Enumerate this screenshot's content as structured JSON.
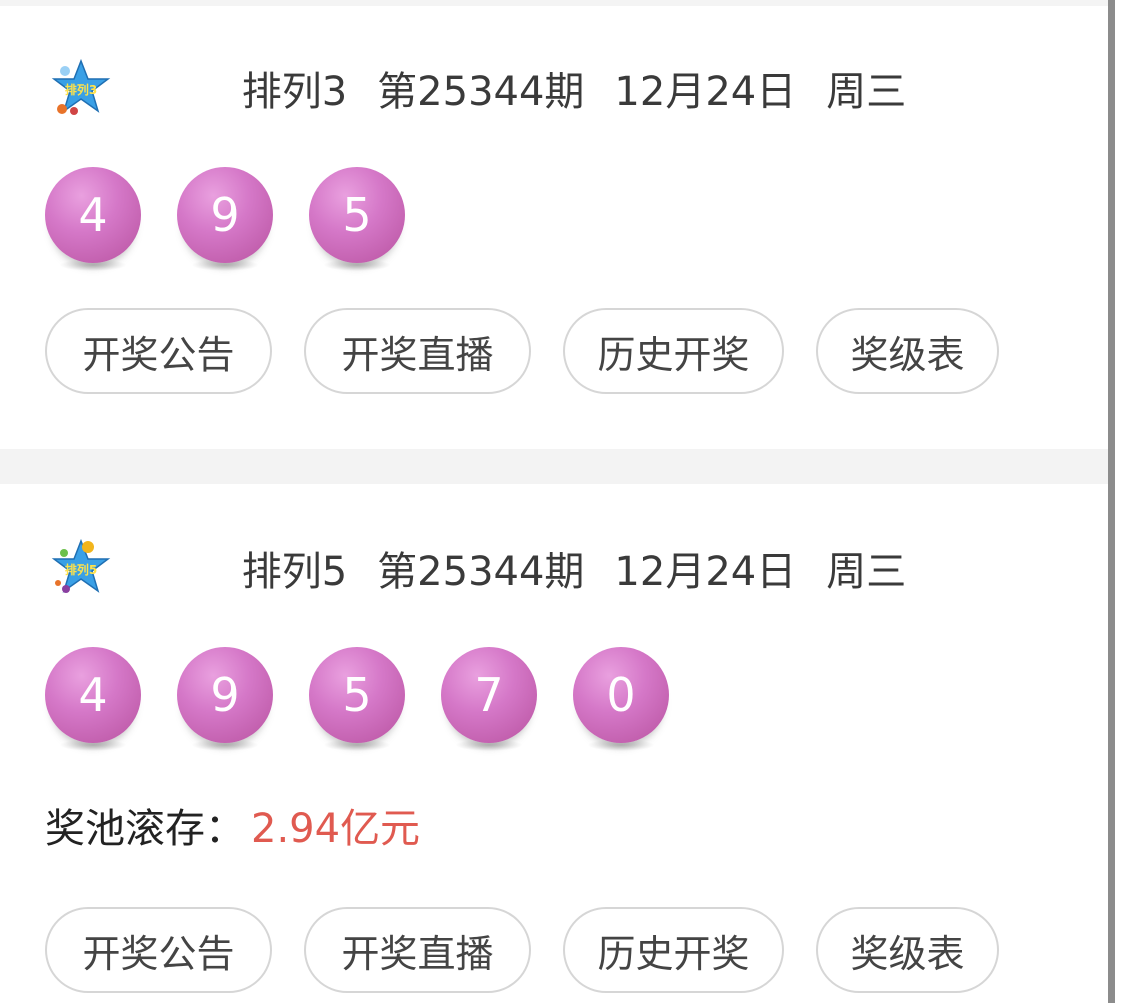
{
  "colors": {
    "ball": "#d578c8",
    "ball_text": "#ffffff",
    "jackpot_value": "#e05a50",
    "pill_border": "#d6d6d6",
    "separator": "#f3f3f3"
  },
  "sections": [
    {
      "logo_icon": "pailie3-logo-icon",
      "logo_text": "排列3",
      "name": "排列3",
      "issue": "第25344期",
      "date": "12月24日",
      "weekday": "周三",
      "balls": [
        "4",
        "9",
        "5"
      ],
      "buttons": [
        "开奖公告",
        "开奖直播",
        "历史开奖",
        "奖级表"
      ]
    },
    {
      "logo_icon": "pailie5-logo-icon",
      "logo_text": "排列5",
      "name": "排列5",
      "issue": "第25344期",
      "date": "12月24日",
      "weekday": "周三",
      "balls": [
        "4",
        "9",
        "5",
        "7",
        "0"
      ],
      "jackpot_label": "奖池滚存：",
      "jackpot_value": "2.94亿元",
      "buttons": [
        "开奖公告",
        "开奖直播",
        "历史开奖",
        "奖级表"
      ]
    }
  ]
}
